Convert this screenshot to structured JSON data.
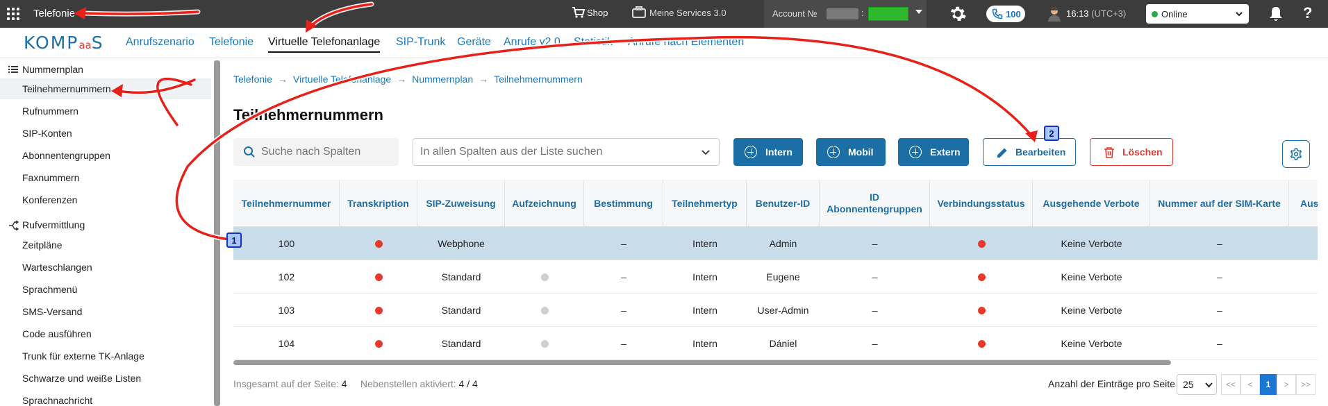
{
  "topbar": {
    "app_title": "Telefonie",
    "shop": "Shop",
    "services": "Meine Services 3.0",
    "account_label": "Account №",
    "phone_count": "100",
    "time": "16:13",
    "timezone": "(UTC+3)",
    "status": "Online",
    "help": "?"
  },
  "logo": {
    "main": "KOMP",
    "aa": "aa",
    "end": "S"
  },
  "nav": {
    "items": [
      "Anrufszenario",
      "Telefonie",
      "Virtuelle Telefonanlage",
      "SIP-Trunk",
      "Geräte",
      "Anrufe v2.0",
      "Statistik",
      "Anrufe nach Elementen"
    ]
  },
  "sidebar": {
    "group1": "Nummernplan",
    "group1_items": [
      "Teilnehmernummern",
      "Rufnummern",
      "SIP-Konten",
      "Abonnentengruppen",
      "Faxnummern",
      "Konferenzen"
    ],
    "group2": "Rufvermittlung",
    "group2_items": [
      "Zeitpläne",
      "Warteschlangen",
      "Sprachmenü",
      "SMS-Versand",
      "Code ausführen",
      "Trunk für externe TK-Anlage",
      "Schwarze und weiße Listen",
      "Sprachnachricht"
    ]
  },
  "breadcrumb": [
    "Telefonie",
    "Virtuelle Telefonanlage",
    "Nummernplan",
    "Teilnehmernummern"
  ],
  "page": {
    "title": "Teilnehmernummern",
    "search_placeholder": "Suche nach Spalten",
    "list_search_placeholder": "In allen Spalten aus der Liste suchen",
    "btn_intern": "Intern",
    "btn_mobil": "Mobil",
    "btn_extern": "Extern",
    "btn_edit": "Bearbeiten",
    "btn_delete": "Löschen"
  },
  "table": {
    "headers": [
      "Teilnehmernummer",
      "Transkription",
      "SIP-Zuweisung",
      "Aufzeichnung",
      "Bestimmung",
      "Teilnehmertyp",
      "Benutzer-ID",
      "ID Abonnentengruppen",
      "Verbindungsstatus",
      "Ausgehende Verbote",
      "Nummer auf der SIM-Karte",
      "Ausg"
    ],
    "rows": [
      {
        "number": "100",
        "transcription": "red",
        "sip": "Webphone",
        "recording": "none",
        "destination": "–",
        "type": "Intern",
        "user": "Admin",
        "group": "–",
        "connection": "red",
        "bans": "Keine Verbote",
        "sim": "–",
        "extra": "+"
      },
      {
        "number": "102",
        "transcription": "red",
        "sip": "Standard",
        "recording": "gray",
        "destination": "–",
        "type": "Intern",
        "user": "Eugene",
        "group": "–",
        "connection": "red",
        "bans": "Keine Verbote",
        "sim": "–",
        "extra": "+"
      },
      {
        "number": "103",
        "transcription": "red",
        "sip": "Standard",
        "recording": "gray",
        "destination": "–",
        "type": "Intern",
        "user": "User-Admin",
        "group": "–",
        "connection": "red",
        "bans": "Keine Verbote",
        "sim": "–",
        "extra": "+"
      },
      {
        "number": "104",
        "transcription": "red",
        "sip": "Standard",
        "recording": "gray",
        "destination": "–",
        "type": "Intern",
        "user": "Dániel",
        "group": "–",
        "connection": "red",
        "bans": "Keine Verbote",
        "sim": "–",
        "extra": "+"
      }
    ]
  },
  "footer": {
    "total_label": "Insgesamt auf der Seite:",
    "total_value": "4",
    "ext_label": "Nebenstellen aktiviert:",
    "ext_value": "4 / 4",
    "per_page_label": "Anzahl der Einträge pro Seite",
    "per_page_value": "25",
    "pager": [
      "<<",
      "<",
      "1",
      ">",
      ">>"
    ]
  },
  "annotations": {
    "badge1": "1",
    "badge2": "2"
  },
  "colors": {
    "primary": "#1c6fa5",
    "danger": "#e03a2f",
    "selected_row": "#c9dce9",
    "arrow": "#e8201a"
  }
}
